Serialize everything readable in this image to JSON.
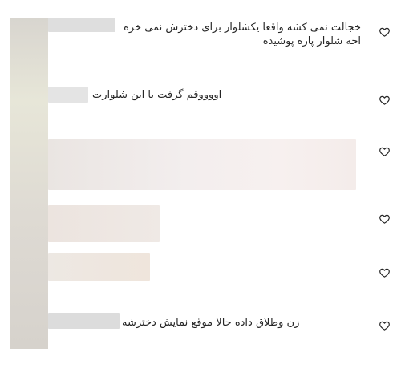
{
  "comments": [
    {
      "lines": [
        "خجالت نمی کشه واقعا یکشلوار برای دخترش نمی خره",
        "اخه شلوار پاره پوشیده"
      ],
      "like_icon": "heart-outline-icon"
    },
    {
      "lines": [
        "اووووقم گرفت با این شلوارت"
      ],
      "like_icon": "heart-outline-icon"
    },
    {
      "lines": [],
      "like_icon": "heart-outline-icon"
    },
    {
      "lines": [],
      "like_icon": "heart-outline-icon"
    },
    {
      "lines": [],
      "like_icon": "heart-outline-icon"
    },
    {
      "lines": [
        "زن وطلاق داده حالا موقع نمایش دخترشه"
      ],
      "like_icon": "heart-outline-icon"
    }
  ],
  "colors": {
    "text": "#262626",
    "heart": "#262626",
    "blur_gray": "#dcdcdc",
    "blur_beige": "#efe7e1"
  }
}
